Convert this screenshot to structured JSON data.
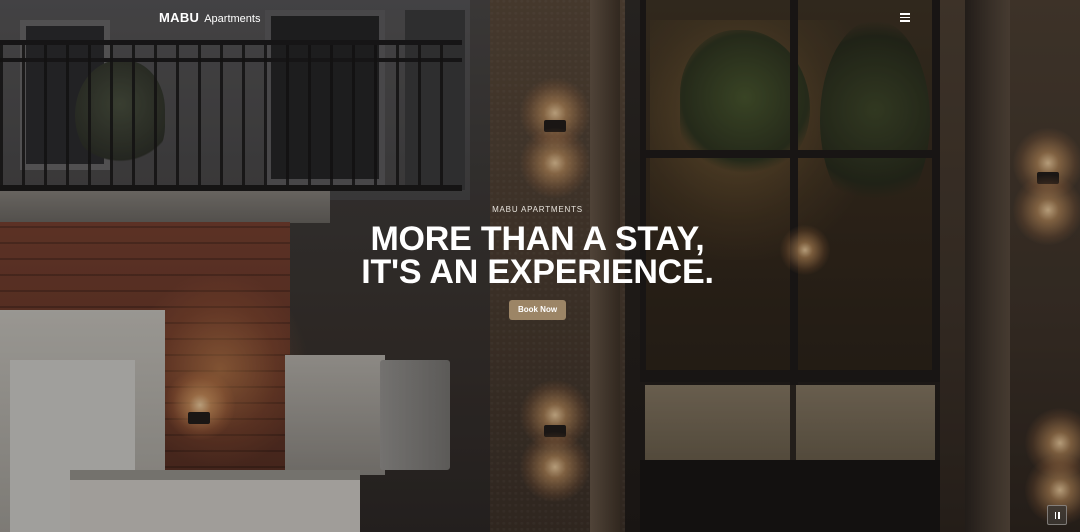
{
  "navbar": {
    "brand_bold": "MABU",
    "brand_light": "Apartments",
    "menu_icon": "hamburger-menu-icon"
  },
  "hero": {
    "eyebrow": "MABU APARTMENTS",
    "headline_line1": "MORE THAN A STAY,",
    "headline_line2": "IT'S AN EXPERIENCE.",
    "cta_label": "Book Now",
    "cta_color": "#9c8566"
  },
  "video_control": {
    "icon": "pause-icon"
  },
  "colors": {
    "text": "#ffffff",
    "accent": "#9c8566"
  }
}
